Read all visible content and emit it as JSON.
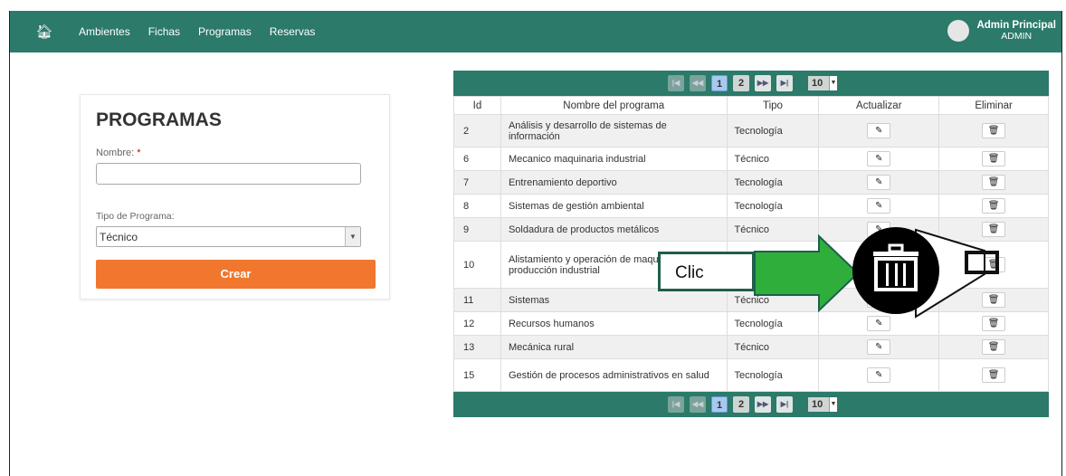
{
  "navbar": {
    "links": [
      "Ambientes",
      "Fichas",
      "Programas",
      "Reservas"
    ],
    "user_name": "Admin Principal",
    "user_role": "ADMIN"
  },
  "form": {
    "title": "PROGRAMAS",
    "name_label": "Nombre:",
    "name_required": "*",
    "name_value": "",
    "type_label": "Tipo de Programa:",
    "type_value": "Técnico",
    "create_label": "Crear"
  },
  "pager": {
    "pages": [
      "1",
      "2"
    ],
    "current_page": "1",
    "page_size": "10"
  },
  "table": {
    "headers": [
      "Id",
      "Nombre del programa",
      "Tipo",
      "Actualizar",
      "Eliminar"
    ],
    "rows": [
      {
        "id": "2",
        "name": "Análisis y desarrollo de sistemas de información",
        "tipo": "Tecnología"
      },
      {
        "id": "6",
        "name": "Mecanico maquinaria industrial",
        "tipo": "Técnico"
      },
      {
        "id": "7",
        "name": "Entrenamiento deportivo",
        "tipo": "Tecnología"
      },
      {
        "id": "8",
        "name": "Sistemas de gestión ambiental",
        "tipo": "Tecnología"
      },
      {
        "id": "9",
        "name": "Soldadura de productos metálicos",
        "tipo": "Técnico"
      },
      {
        "id": "10",
        "name": "Alistamiento y operación de maquinaria para la producción industrial",
        "tipo": ""
      },
      {
        "id": "11",
        "name": "Sistemas",
        "tipo": "Técnico"
      },
      {
        "id": "12",
        "name": "Recursos humanos",
        "tipo": "Tecnología"
      },
      {
        "id": "13",
        "name": "Mecánica rural",
        "tipo": "Técnico"
      },
      {
        "id": "15",
        "name": "Gestión de procesos administrativos en salud",
        "tipo": "Tecnología"
      }
    ]
  },
  "annotation": {
    "click_label": "Clic",
    "arrow_color": "#2fae3c",
    "box_border_color": "#1f5f4c"
  },
  "icons": {
    "home": "home-icon",
    "edit": "edit-icon",
    "delete": "trash-icon"
  },
  "colors": {
    "navbar": "#2b7a6a",
    "create_button": "#f0772d"
  }
}
